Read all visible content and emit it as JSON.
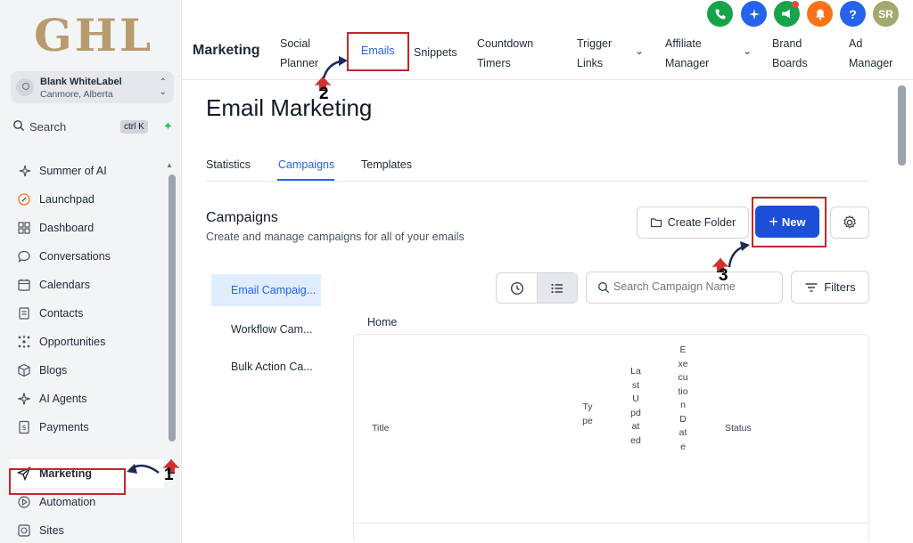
{
  "brand": {
    "logo_text": "GHL"
  },
  "account": {
    "name": "Blank WhiteLabel",
    "location": "Canmore, Alberta"
  },
  "search": {
    "label": "Search",
    "shortcut": "ctrl K"
  },
  "sidebar": {
    "items": [
      {
        "label": "Summer of AI",
        "icon": "sparkle-icon"
      },
      {
        "label": "Launchpad",
        "icon": "launchpad-icon"
      },
      {
        "label": "Dashboard",
        "icon": "dashboard-icon"
      },
      {
        "label": "Conversations",
        "icon": "chat-icon"
      },
      {
        "label": "Calendars",
        "icon": "calendar-icon"
      },
      {
        "label": "Contacts",
        "icon": "contacts-icon"
      },
      {
        "label": "Opportunities",
        "icon": "opportunities-icon"
      },
      {
        "label": "Blogs",
        "icon": "cube-icon"
      },
      {
        "label": "AI Agents",
        "icon": "sparkle-icon"
      },
      {
        "label": "Payments",
        "icon": "receipt-icon"
      },
      {
        "label": "Marketing",
        "icon": "send-icon",
        "active": true
      },
      {
        "label": "Automation",
        "icon": "automation-icon"
      },
      {
        "label": "Sites",
        "icon": "globe-icon"
      }
    ]
  },
  "topbar": {
    "section": "Marketing",
    "tabs": {
      "social_1": "Social",
      "social_2": "Planner",
      "emails": "Emails",
      "snippets": "Snippets",
      "countdown_1": "Countdown",
      "countdown_2": "Timers",
      "trigger_1": "Trigger",
      "trigger_2": "Links",
      "affiliate_1": "Affiliate",
      "affiliate_2": "Manager",
      "brand_1": "Brand",
      "brand_2": "Boards",
      "ad_1": "Ad",
      "ad_2": "Manager"
    },
    "avatar_initials": "SR",
    "help": "?",
    "colors": {
      "phone": "#16a34a",
      "ai": "#2563eb",
      "announce": "#16a34a",
      "bell": "#f97316",
      "help": "#2563eb",
      "avatar": "#a3a86c"
    }
  },
  "page": {
    "title": "Email Marketing",
    "subtabs": {
      "statistics": "Statistics",
      "campaigns": "Campaigns",
      "templates": "Templates"
    },
    "section_title": "Campaigns",
    "section_subtitle": "Create and manage campaigns for all of your emails",
    "create_folder_label": "Create Folder",
    "new_label": "New",
    "search_placeholder": "Search Campaign Name",
    "filters_label": "Filters",
    "folders": [
      "Email Campaig...",
      "Workflow Cam...",
      "Bulk Action Ca..."
    ],
    "breadcrumb": "Home",
    "table": {
      "title": "Title",
      "type": "Type",
      "last_updated": "LastUpdated",
      "execution_date": "ExecutionDate",
      "status": "Status"
    }
  },
  "annotations": {
    "step1": "1",
    "step2": "2",
    "step3": "3"
  },
  "accent_color": "#2563eb",
  "highlight_color": "#c1272d"
}
